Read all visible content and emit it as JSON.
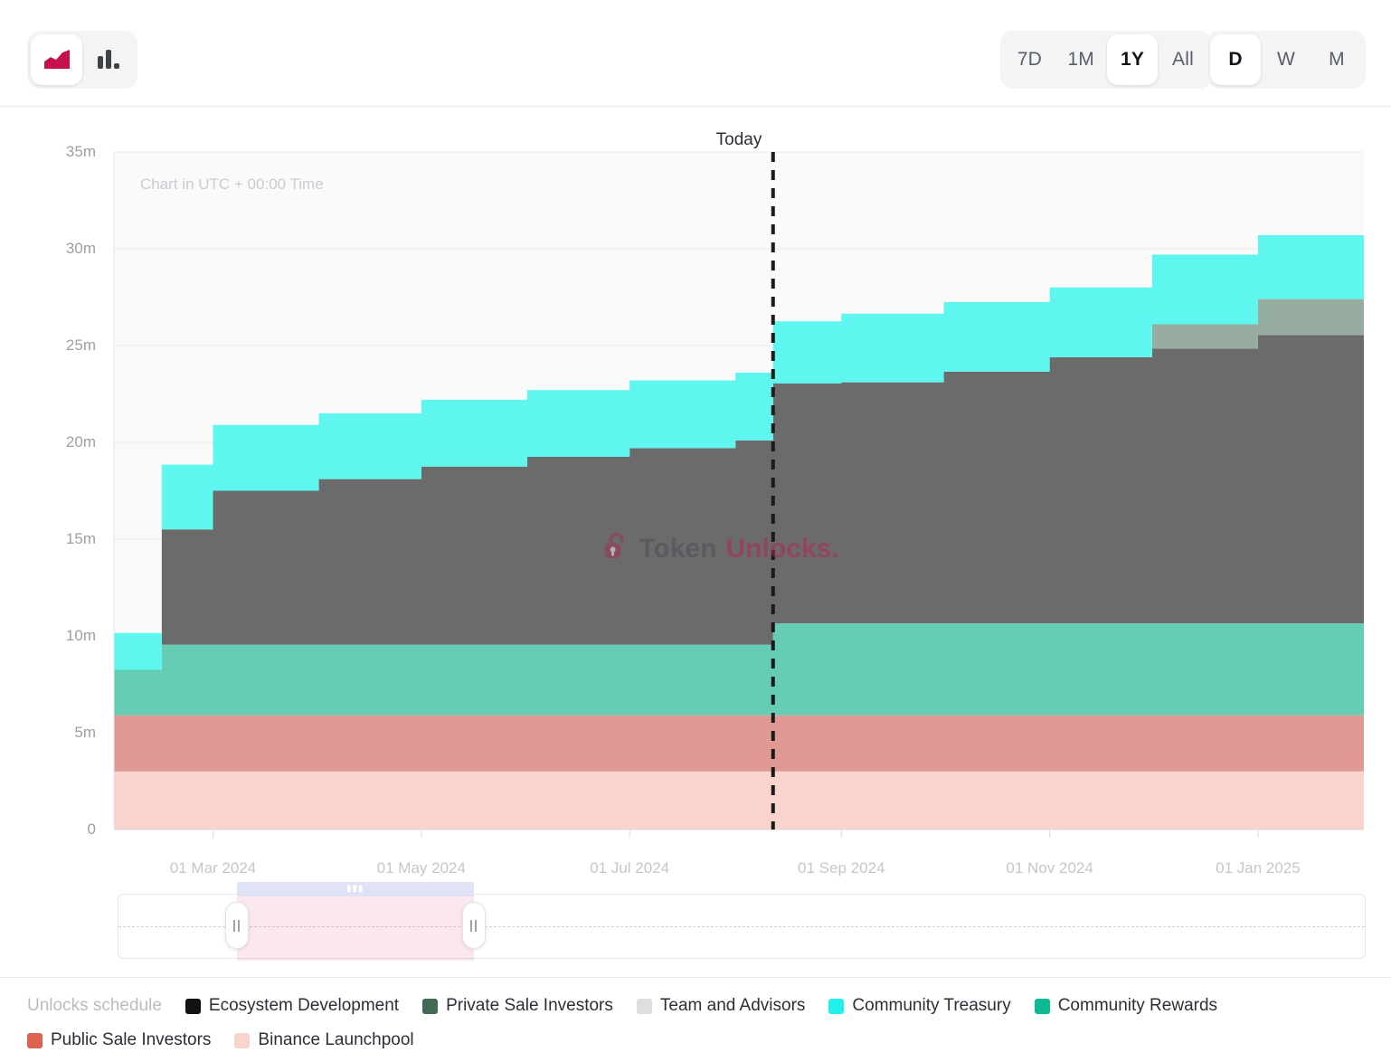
{
  "toolbar": {
    "chart_types": [
      {
        "name": "area-chart",
        "label": "Area chart",
        "active": true
      },
      {
        "name": "bar-chart",
        "label": "Bar chart",
        "active": false
      }
    ],
    "period_buttons": [
      {
        "label": "7D",
        "active": false
      },
      {
        "label": "1M",
        "active": false
      },
      {
        "label": "1Y",
        "active": true
      },
      {
        "label": "All",
        "active": false
      }
    ],
    "granularity_buttons": [
      {
        "label": "D",
        "active": true
      },
      {
        "label": "W",
        "active": false
      },
      {
        "label": "M",
        "active": false
      }
    ]
  },
  "chart_notes": {
    "today_label": "Today",
    "utc_note": "Chart in UTC + 00:00 Time",
    "watermark_primary": "Token",
    "watermark_secondary": "Unlocks."
  },
  "legend": {
    "title": "Unlocks schedule",
    "items": [
      {
        "label": "Ecosystem Development",
        "color": "#111111"
      },
      {
        "label": "Private Sale Investors",
        "color": "#3e6b52"
      },
      {
        "label": "Team and Advisors",
        "color": "#dedede"
      },
      {
        "label": "Community Treasury",
        "color": "#22f0eb"
      },
      {
        "label": "Community Rewards",
        "color": "#0fb992"
      },
      {
        "label": "Public Sale Investors",
        "color": "#dd6250"
      },
      {
        "label": "Binance Launchpool",
        "color": "#fbd3cd"
      }
    ]
  },
  "slider": {
    "selection_start_pct": 9.5,
    "selection_end_pct": 28.5,
    "handle_names": [
      "slider-handle-left",
      "slider-handle-right"
    ]
  },
  "chart_data": {
    "type": "area",
    "title": "",
    "xlabel": "",
    "ylabel": "",
    "ylim": [
      0,
      35000000
    ],
    "grid": true,
    "legend_position": "bottom",
    "stacked": true,
    "step": "post",
    "today_x": "2024-08-12",
    "ytick_labels": [
      "0",
      "5m",
      "10m",
      "15m",
      "20m",
      "25m",
      "30m",
      "35m"
    ],
    "ytick_values": [
      0,
      5000000,
      10000000,
      15000000,
      20000000,
      25000000,
      30000000,
      35000000
    ],
    "xtick_labels": [
      "01 Mar 2024",
      "01 May 2024",
      "01 Jul 2024",
      "01 Sep 2024",
      "01 Nov 2024",
      "01 Jan 2025"
    ],
    "x": [
      "2024-02-01",
      "2024-02-15",
      "2024-03-01",
      "2024-04-01",
      "2024-05-01",
      "2024-06-01",
      "2024-07-01",
      "2024-08-01",
      "2024-08-12",
      "2024-09-01",
      "2024-10-01",
      "2024-11-01",
      "2024-12-01",
      "2025-01-01",
      "2025-02-01"
    ],
    "series": [
      {
        "name": "Binance Launchpool",
        "color": "#fbd3cd",
        "values": [
          3000000,
          3000000,
          3000000,
          3000000,
          3000000,
          3000000,
          3000000,
          3000000,
          3000000,
          3000000,
          3000000,
          3000000,
          3000000,
          3000000,
          3000000
        ]
      },
      {
        "name": "Public Sale Investors",
        "color": "#e09a93",
        "values": [
          2900000,
          2900000,
          2900000,
          2900000,
          2900000,
          2900000,
          2900000,
          2900000,
          2900000,
          2900000,
          2900000,
          2900000,
          2900000,
          2900000,
          2900000
        ]
      },
      {
        "name": "Community Rewards",
        "color": "#66ccb4",
        "values": [
          2350000,
          3650000,
          3650000,
          3650000,
          3650000,
          3650000,
          3650000,
          3650000,
          4750000,
          4750000,
          4750000,
          4750000,
          4750000,
          4750000,
          4750000
        ]
      },
      {
        "name": "Team and Advisors",
        "color": "#6b6b6b",
        "values": [
          0,
          5950000,
          7950000,
          8550000,
          9200000,
          9700000,
          10150000,
          10550000,
          12400000,
          12450000,
          13000000,
          13750000,
          14200000,
          14900000,
          15100000
        ]
      },
      {
        "name": "Private Sale Investors",
        "color": "#96ad9f",
        "values": [
          0,
          0,
          0,
          0,
          0,
          0,
          0,
          0,
          0,
          0,
          0,
          0,
          1250000,
          1850000,
          2100000
        ]
      },
      {
        "name": "Community Treasury",
        "color": "#5ef6ef",
        "values": [
          1900000,
          3350000,
          3400000,
          3400000,
          3450000,
          3450000,
          3500000,
          3500000,
          3200000,
          3550000,
          3600000,
          3600000,
          3600000,
          3300000,
          3950000
        ]
      }
    ],
    "totals": [
      10150000,
      18850000,
      20800000,
      21400000,
      22100000,
      22600000,
      23050000,
      23450000,
      26150000,
      26550000,
      27200000,
      27950000,
      29650000,
      30650000,
      31750000
    ]
  }
}
